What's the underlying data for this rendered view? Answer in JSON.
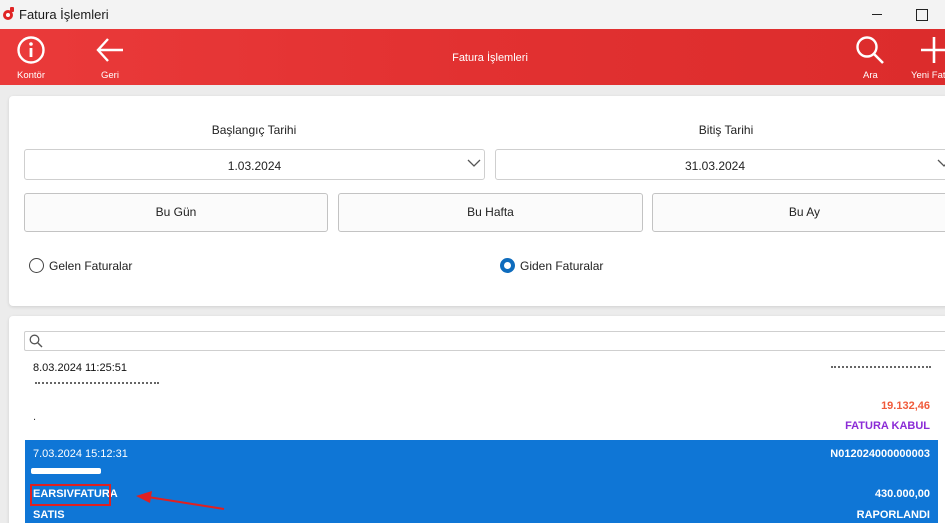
{
  "window": {
    "title": "Fatura İşlemleri"
  },
  "appbar": {
    "title": "Fatura İşlemleri",
    "kontor_label": "Kontör",
    "geri_label": "Geri",
    "ara_label": "Ara",
    "yeni_label": "Yeni Fatura",
    "color": "#e23131"
  },
  "filters": {
    "start_label": "Başlangıç Tarihi",
    "start_value": "1.03.2024",
    "end_label": "Bitiş Tarihi",
    "end_value": "31.03.2024",
    "quick": [
      "Bu Gün",
      "Bu Hafta",
      "Bu Ay"
    ],
    "radio": [
      {
        "label": "Gelen Faturalar",
        "checked": false
      },
      {
        "label": "Giden Faturalar",
        "checked": true
      }
    ]
  },
  "search": {
    "placeholder": ""
  },
  "invoices": [
    {
      "datetime": "8.03.2024 11:25:51",
      "note": ".",
      "amount": "19.132,46",
      "status": "FATURA KABUL",
      "amount_color": "#f05a3a",
      "status_color": "#8b2bd6"
    },
    {
      "datetime": "7.03.2024 15:12:31",
      "number": "N012024000000003",
      "type": "EARSIVFATURA",
      "amount": "430.000,00",
      "category": "SATIS",
      "status": "RAPORLANDI",
      "selected_color": "#0f76d6"
    }
  ]
}
